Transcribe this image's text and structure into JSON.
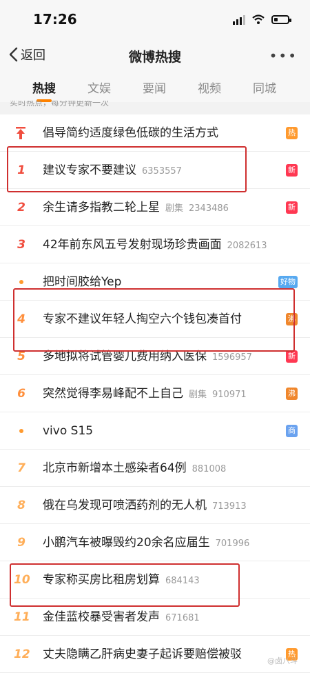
{
  "status_bar": {
    "time": "17:26",
    "battery_level": 0.25
  },
  "nav": {
    "back_label": "返回",
    "title": "微博热搜",
    "more_label": "•••"
  },
  "tabs": [
    {
      "label": "热搜",
      "active": true
    },
    {
      "label": "文娱",
      "active": false
    },
    {
      "label": "要闻",
      "active": false
    },
    {
      "label": "视频",
      "active": false
    },
    {
      "label": "同城",
      "active": false
    }
  ],
  "notice": "实时热点，每分钟更新一次",
  "colors": {
    "accent": "#ff8200",
    "rank_top": "#f04d3e",
    "rank_mid": "#ff8f3c",
    "rank_low": "#ffae58",
    "highlight_box": "#cf2f2f"
  },
  "rows": [
    {
      "rank": "",
      "marker": "pinned-top",
      "title": "倡导简约适度绿色低碳的生活方式",
      "category": "",
      "heat": "",
      "badge": "热",
      "badge_color": "#ff9a2e"
    },
    {
      "rank": "1",
      "marker": "",
      "title": "建议专家不要建议",
      "category": "",
      "heat": "6353557",
      "badge": "新",
      "badge_color": "#ff3852"
    },
    {
      "rank": "2",
      "marker": "",
      "title": "余生请多指教二轮上星",
      "category": "剧集",
      "heat": "2343486",
      "badge": "新",
      "badge_color": "#ff3852"
    },
    {
      "rank": "3",
      "marker": "",
      "title": "42年前东风五号发射现场珍贵画面",
      "category": "",
      "heat": "2082613",
      "badge": "",
      "badge_color": ""
    },
    {
      "rank": "",
      "marker": "dot",
      "title": "把时间胶给Yep",
      "category": "",
      "heat": "",
      "badge": "好物",
      "badge_color": "#57a9f0"
    },
    {
      "rank": "4",
      "marker": "",
      "title": "专家不建议年轻人掏空六个钱包凑首付",
      "category": "",
      "heat": "",
      "badge": "沸",
      "badge_color": "#f0872d"
    },
    {
      "rank": "5",
      "marker": "",
      "title": "多地拟将试管婴儿费用纳入医保",
      "category": "",
      "heat": "1596957",
      "badge": "新",
      "badge_color": "#ff3852"
    },
    {
      "rank": "6",
      "marker": "",
      "title": "突然觉得李易峰配不上自己",
      "category": "剧集",
      "heat": "910971",
      "badge": "沸",
      "badge_color": "#f0872d"
    },
    {
      "rank": "",
      "marker": "dot",
      "title": "vivo S15",
      "category": "",
      "heat": "",
      "badge": "商",
      "badge_color": "#6aa2ef"
    },
    {
      "rank": "7",
      "marker": "",
      "title": "北京市新增本土感染者64例",
      "category": "",
      "heat": "881008",
      "badge": "",
      "badge_color": ""
    },
    {
      "rank": "8",
      "marker": "",
      "title": "俄在乌发现可喷洒药剂的无人机",
      "category": "",
      "heat": "713913",
      "badge": "",
      "badge_color": ""
    },
    {
      "rank": "9",
      "marker": "",
      "title": "小鹏汽车被曝毁约20余名应届生",
      "category": "",
      "heat": "701996",
      "badge": "",
      "badge_color": ""
    },
    {
      "rank": "10",
      "marker": "",
      "title": "专家称买房比租房划算",
      "category": "",
      "heat": "684143",
      "badge": "",
      "badge_color": ""
    },
    {
      "rank": "11",
      "marker": "",
      "title": "金佳蓝校暴受害者发声",
      "category": "",
      "heat": "671681",
      "badge": "",
      "badge_color": ""
    },
    {
      "rank": "12",
      "marker": "",
      "title": "丈夫隐瞒乙肝病史妻子起诉要赔偿被驳",
      "category": "",
      "heat": "",
      "badge": "热",
      "badge_color": "#ff9a2e"
    }
  ],
  "watermark": "@卤八斗"
}
